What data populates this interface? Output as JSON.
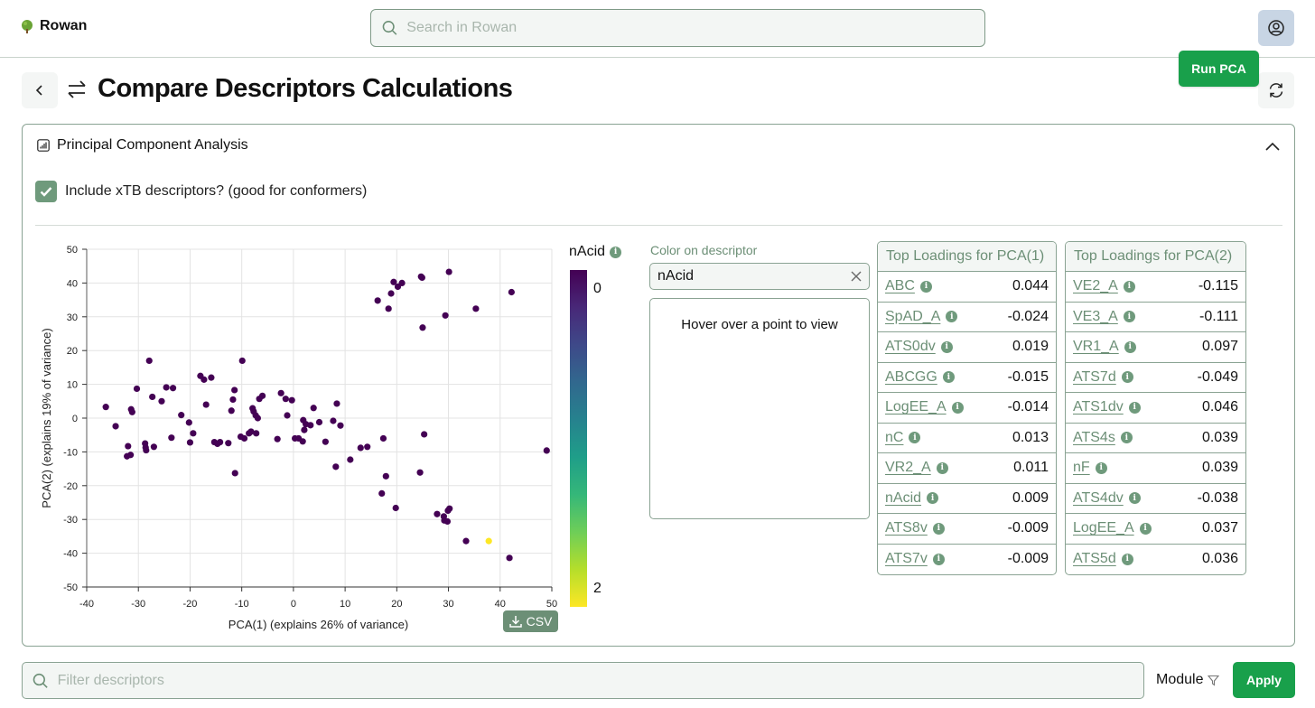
{
  "app": {
    "name": "Rowan"
  },
  "header": {
    "search_placeholder": "Search in Rowan"
  },
  "page": {
    "title": "Compare Descriptors Calculations"
  },
  "panel": {
    "title": "Principal Component Analysis",
    "include_xtb_label": "Include xTB descriptors? (good for conformers)",
    "include_xtb_checked": true,
    "run_button": "Run PCA",
    "csv_button": "CSV"
  },
  "colorbar": {
    "title": "nAcid",
    "min_label": "0",
    "max_label": "2"
  },
  "descriptor": {
    "label": "Color on descriptor",
    "value": "nAcid",
    "hover_text": "Hover over a point to view"
  },
  "loadings_pca1": {
    "title": "Top Loadings for PCA(1)",
    "rows": [
      {
        "name": "ABC",
        "value": "0.044"
      },
      {
        "name": "SpAD_A",
        "value": "-0.024"
      },
      {
        "name": "ATS0dv",
        "value": "0.019"
      },
      {
        "name": "ABCGG",
        "value": "-0.015"
      },
      {
        "name": "LogEE_A",
        "value": "-0.014"
      },
      {
        "name": "nC",
        "value": "0.013"
      },
      {
        "name": "VR2_A",
        "value": "0.011"
      },
      {
        "name": "nAcid",
        "value": "0.009"
      },
      {
        "name": "ATS8v",
        "value": "-0.009"
      },
      {
        "name": "ATS7v",
        "value": "-0.009"
      }
    ]
  },
  "loadings_pca2": {
    "title": "Top Loadings for PCA(2)",
    "rows": [
      {
        "name": "VE2_A",
        "value": "-0.115"
      },
      {
        "name": "VE3_A",
        "value": "-0.111"
      },
      {
        "name": "VR1_A",
        "value": "0.097"
      },
      {
        "name": "ATS7d",
        "value": "-0.049"
      },
      {
        "name": "ATS1dv",
        "value": "0.046"
      },
      {
        "name": "ATS4s",
        "value": "0.039"
      },
      {
        "name": "nF",
        "value": "0.039"
      },
      {
        "name": "ATS4dv",
        "value": "-0.038"
      },
      {
        "name": "LogEE_A",
        "value": "0.037"
      },
      {
        "name": "ATS5d",
        "value": "0.036"
      }
    ]
  },
  "footer": {
    "filter_placeholder": "Filter descriptors",
    "module_label": "Module",
    "apply_button": "Apply"
  },
  "colors": {
    "accent_green": "#19a04b",
    "muted_green": "#6c8f76",
    "point_low": "#440154",
    "point_high": "#fde725"
  },
  "chart_data": {
    "type": "scatter",
    "title": "",
    "xlabel": "PCA(1) (explains 26% of variance)",
    "ylabel": "PCA(2) (explains 19% of variance)",
    "xlim": [
      -40,
      50
    ],
    "ylim": [
      -50,
      50
    ],
    "xticks": [
      -40,
      -30,
      -20,
      -10,
      0,
      10,
      20,
      30,
      40,
      50
    ],
    "yticks": [
      -50,
      -40,
      -30,
      -20,
      -10,
      0,
      10,
      20,
      30,
      40,
      50
    ],
    "grid": true,
    "color_by": "nAcid",
    "color_range": [
      0,
      2
    ],
    "points": [
      {
        "x": -36.3,
        "y": 3.3,
        "c": 0
      },
      {
        "x": -34.4,
        "y": -2.4,
        "c": 0
      },
      {
        "x": -32.0,
        "y": -8.3,
        "c": 0
      },
      {
        "x": -32.2,
        "y": -11.3,
        "c": 0
      },
      {
        "x": -31.5,
        "y": -10.9,
        "c": 0
      },
      {
        "x": -31.4,
        "y": 2.6,
        "c": 0
      },
      {
        "x": -31.2,
        "y": 1.8,
        "c": 0
      },
      {
        "x": -30.3,
        "y": 8.7,
        "c": 0
      },
      {
        "x": -28.7,
        "y": -7.5,
        "c": 0
      },
      {
        "x": -28.6,
        "y": -8.7,
        "c": 0
      },
      {
        "x": -28.5,
        "y": -9.5,
        "c": 0
      },
      {
        "x": -27.9,
        "y": 17.0,
        "c": 0
      },
      {
        "x": -27.3,
        "y": 6.3,
        "c": 0
      },
      {
        "x": -27.0,
        "y": -8.5,
        "c": 0
      },
      {
        "x": -25.5,
        "y": 5.0,
        "c": 0
      },
      {
        "x": -24.6,
        "y": 9.1,
        "c": 0
      },
      {
        "x": -23.6,
        "y": -5.8,
        "c": 0
      },
      {
        "x": -23.3,
        "y": 8.9,
        "c": 0
      },
      {
        "x": -21.7,
        "y": 0.9,
        "c": 0
      },
      {
        "x": -20.2,
        "y": -1.3,
        "c": 0
      },
      {
        "x": -20.0,
        "y": -7.2,
        "c": 0
      },
      {
        "x": -19.4,
        "y": -4.5,
        "c": 0
      },
      {
        "x": -18.0,
        "y": 12.5,
        "c": 0
      },
      {
        "x": -17.3,
        "y": 11.4,
        "c": 0
      },
      {
        "x": -16.9,
        "y": 4.0,
        "c": 0
      },
      {
        "x": -15.9,
        "y": 12.0,
        "c": 0
      },
      {
        "x": -15.3,
        "y": -7.1,
        "c": 0
      },
      {
        "x": -14.7,
        "y": -7.6,
        "c": 0
      },
      {
        "x": -14.2,
        "y": -7.1,
        "c": 0
      },
      {
        "x": -12.6,
        "y": -7.4,
        "c": 0
      },
      {
        "x": -12.0,
        "y": 2.2,
        "c": 0
      },
      {
        "x": -11.7,
        "y": 5.5,
        "c": 0
      },
      {
        "x": -11.4,
        "y": 8.3,
        "c": 0
      },
      {
        "x": -11.3,
        "y": -16.3,
        "c": 0
      },
      {
        "x": -10.2,
        "y": -5.5,
        "c": 0
      },
      {
        "x": -9.9,
        "y": 17.0,
        "c": 0
      },
      {
        "x": -9.5,
        "y": -6.0,
        "c": 0
      },
      {
        "x": -8.6,
        "y": -4.5,
        "c": 0
      },
      {
        "x": -8.2,
        "y": -4.0,
        "c": 0
      },
      {
        "x": -7.9,
        "y": 2.9,
        "c": 0
      },
      {
        "x": -7.7,
        "y": 2.0,
        "c": 0
      },
      {
        "x": -7.3,
        "y": 0.8,
        "c": 0
      },
      {
        "x": -7.2,
        "y": -4.5,
        "c": 0
      },
      {
        "x": -6.9,
        "y": 0.0,
        "c": 0
      },
      {
        "x": -6.6,
        "y": 5.7,
        "c": 0
      },
      {
        "x": -6.0,
        "y": 6.6,
        "c": 0
      },
      {
        "x": -3.1,
        "y": -6.2,
        "c": 0
      },
      {
        "x": -2.4,
        "y": 7.4,
        "c": 0
      },
      {
        "x": -1.5,
        "y": 5.7,
        "c": 0
      },
      {
        "x": -1.2,
        "y": 0.8,
        "c": 0
      },
      {
        "x": -0.3,
        "y": 5.3,
        "c": 0
      },
      {
        "x": 0.3,
        "y": -6.0,
        "c": 0
      },
      {
        "x": 1.0,
        "y": -6.0,
        "c": 0
      },
      {
        "x": 1.8,
        "y": -6.9,
        "c": 0
      },
      {
        "x": 1.9,
        "y": -0.6,
        "c": 0
      },
      {
        "x": 2.1,
        "y": -3.5,
        "c": 0
      },
      {
        "x": 2.4,
        "y": -1.8,
        "c": 0
      },
      {
        "x": 3.3,
        "y": -2.1,
        "c": 0
      },
      {
        "x": 3.9,
        "y": 3.0,
        "c": 0
      },
      {
        "x": 5.0,
        "y": -1.2,
        "c": 0
      },
      {
        "x": 6.2,
        "y": -7.0,
        "c": 0
      },
      {
        "x": 7.7,
        "y": -0.8,
        "c": 0
      },
      {
        "x": 8.2,
        "y": -14.4,
        "c": 0
      },
      {
        "x": 8.4,
        "y": 4.3,
        "c": 0
      },
      {
        "x": 9.1,
        "y": -2.2,
        "c": 0
      },
      {
        "x": 11.0,
        "y": -12.3,
        "c": 0
      },
      {
        "x": 13.0,
        "y": -8.8,
        "c": 0
      },
      {
        "x": 14.3,
        "y": -8.5,
        "c": 0
      },
      {
        "x": 16.3,
        "y": 34.8,
        "c": 0
      },
      {
        "x": 17.1,
        "y": -22.3,
        "c": 0
      },
      {
        "x": 17.4,
        "y": -6.0,
        "c": 0
      },
      {
        "x": 17.9,
        "y": -17.2,
        "c": 0
      },
      {
        "x": 18.4,
        "y": 32.4,
        "c": 0
      },
      {
        "x": 18.9,
        "y": 36.9,
        "c": 0
      },
      {
        "x": 19.4,
        "y": 40.3,
        "c": 0
      },
      {
        "x": 19.8,
        "y": -26.6,
        "c": 0
      },
      {
        "x": 20.2,
        "y": 38.9,
        "c": 0
      },
      {
        "x": 21.0,
        "y": 40.0,
        "c": 0
      },
      {
        "x": 24.5,
        "y": -16.1,
        "c": 0
      },
      {
        "x": 24.7,
        "y": 41.9,
        "c": 0
      },
      {
        "x": 24.9,
        "y": 41.6,
        "c": 0
      },
      {
        "x": 25.0,
        "y": 26.8,
        "c": 0
      },
      {
        "x": 25.3,
        "y": -4.8,
        "c": 0
      },
      {
        "x": 27.8,
        "y": -28.4,
        "c": 0
      },
      {
        "x": 29.1,
        "y": -29.1,
        "c": 0
      },
      {
        "x": 29.2,
        "y": -30.3,
        "c": 0
      },
      {
        "x": 29.4,
        "y": 30.4,
        "c": 0
      },
      {
        "x": 29.8,
        "y": -30.6,
        "c": 0
      },
      {
        "x": 29.9,
        "y": -27.4,
        "c": 0
      },
      {
        "x": 30.2,
        "y": -26.8,
        "c": 0
      },
      {
        "x": 30.1,
        "y": 43.3,
        "c": 0
      },
      {
        "x": 33.4,
        "y": -36.4,
        "c": 0
      },
      {
        "x": 35.3,
        "y": 32.4,
        "c": 0
      },
      {
        "x": 37.8,
        "y": -36.4,
        "c": 2
      },
      {
        "x": 41.8,
        "y": -41.4,
        "c": 0
      },
      {
        "x": 42.2,
        "y": 37.3,
        "c": 0
      },
      {
        "x": 49.0,
        "y": -9.6,
        "c": 0
      }
    ]
  }
}
